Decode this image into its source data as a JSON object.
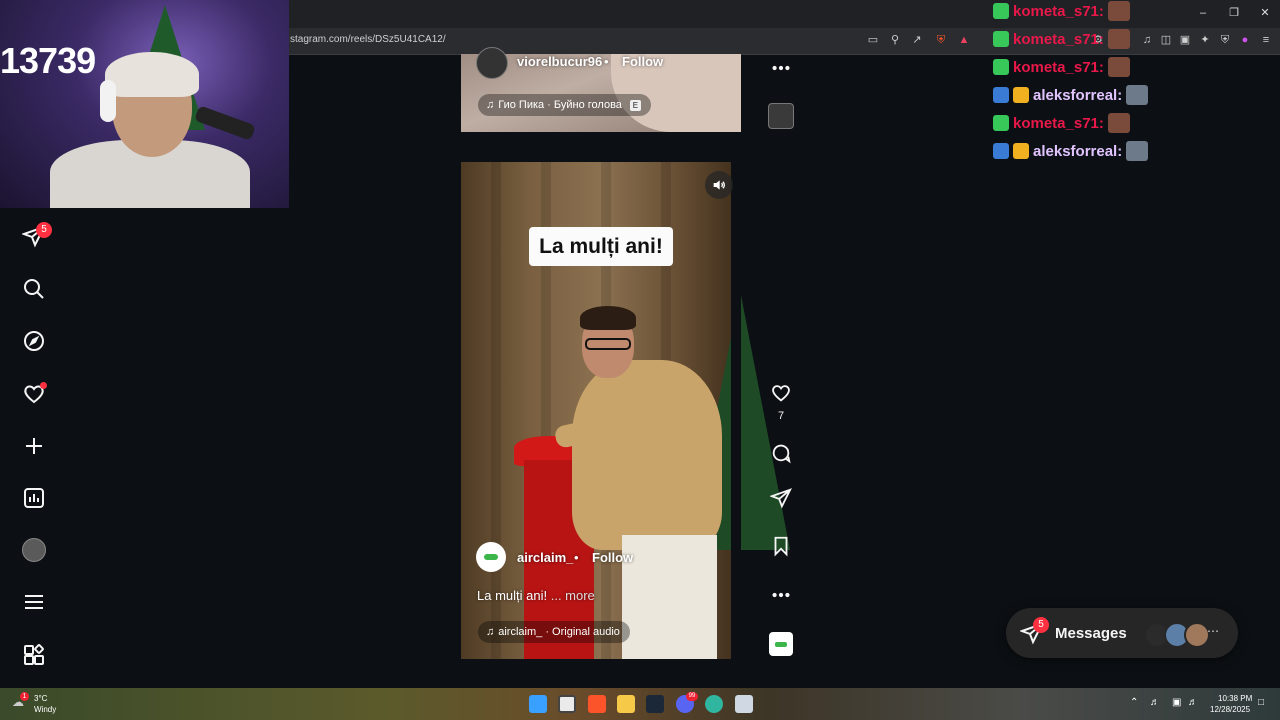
{
  "browser": {
    "url": "stagram.com/reels/DSz5U41CA12/"
  },
  "webcam": {
    "counter": "13739"
  },
  "sidebar": {
    "notification_count": "5",
    "items": [
      {
        "name": "direct-icon"
      },
      {
        "name": "search-icon"
      },
      {
        "name": "explore-icon"
      },
      {
        "name": "heart-icon"
      },
      {
        "name": "create-icon"
      },
      {
        "name": "dashboard-icon"
      },
      {
        "name": "profile-avatar"
      },
      {
        "name": "menu-icon"
      },
      {
        "name": "apps-icon"
      }
    ]
  },
  "reel_top": {
    "username": "viorelbucur96",
    "separator": "•",
    "follow": "Follow",
    "audio": "Гио Пика · Буйно голова",
    "explicit": "E"
  },
  "reel_main": {
    "caption_overlay": "La mulți ani!",
    "username": "airclaim_",
    "separator": "•",
    "follow": "Follow",
    "caption": "La mulți ani!",
    "more": "... more",
    "audio": "airclaim_ · Original audio"
  },
  "actions": {
    "like_count": "7"
  },
  "chat": [
    {
      "user": "kometa_s71:",
      "color": "#e8184a"
    },
    {
      "user": "kometa_s71:",
      "color": "#e8184a"
    },
    {
      "user": "kometa_s71:",
      "color": "#e8184a"
    },
    {
      "user": "aleksforreal:",
      "color": "#e1c4ff"
    },
    {
      "user": "kometa_s71:",
      "color": "#e8184a"
    },
    {
      "user": "aleksforreal:",
      "color": "#e1c4ff"
    }
  ],
  "messages": {
    "label": "Messages",
    "count": "5"
  },
  "taskbar": {
    "weather_temp": "3°C",
    "weather_desc": "Windy",
    "weather_alert": "1",
    "time": "10:38 PM",
    "date": "12/28/2025",
    "discord_badge": "99"
  }
}
